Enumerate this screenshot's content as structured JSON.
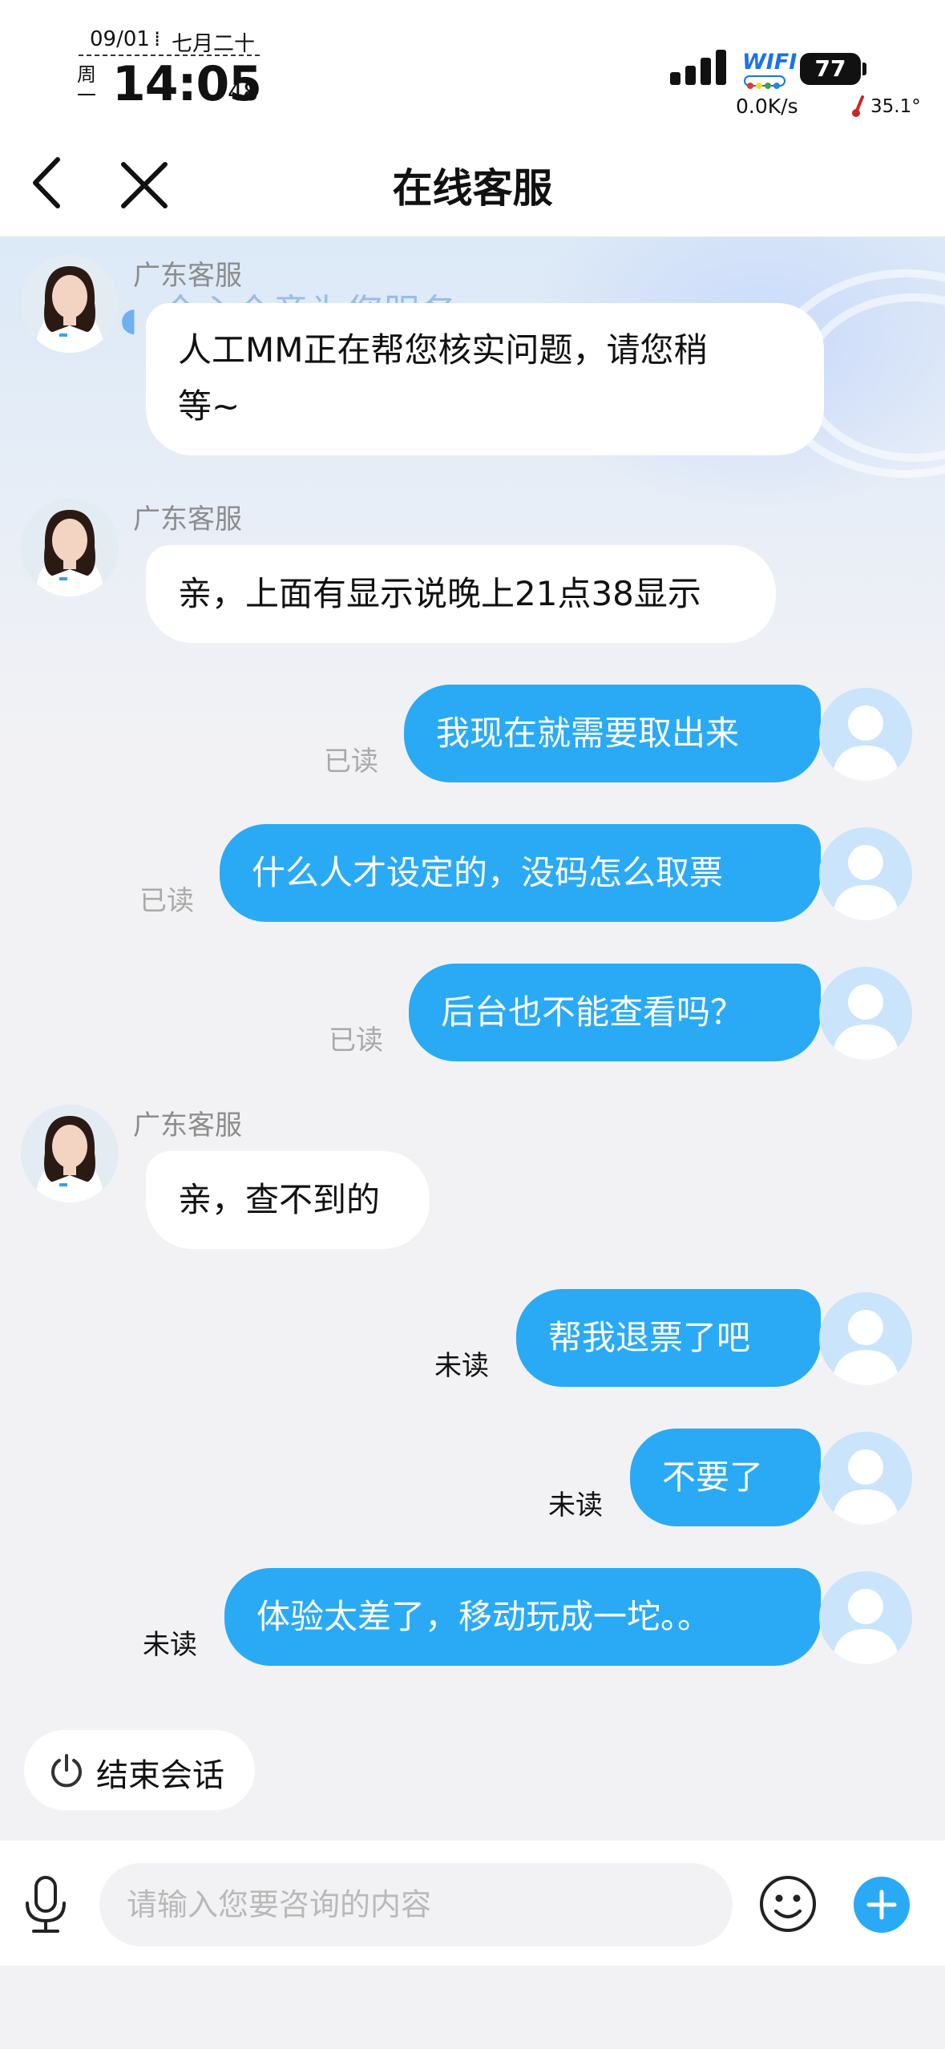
{
  "status_bar": {
    "date": "09/01",
    "lunar": "七月二十",
    "weekday": "周一",
    "time": "14:05",
    "seconds": "48",
    "wifi": "WIFI",
    "battery": "77",
    "net_speed": "0.0K/s",
    "temperature": "35.1°"
  },
  "header": {
    "title": "在线客服"
  },
  "banner": {
    "partial_text": "全心全意为您服务"
  },
  "messages": [
    {
      "sender": "广东客服",
      "text_line1": "人工MM正在帮您核实问题，请您稍",
      "text_line2": "等~"
    },
    {
      "sender": "广东客服",
      "text": "亲，上面有显示说晚上21点38显示"
    },
    {
      "text": "我现在就需要取出来",
      "status": "已读"
    },
    {
      "text": "什么人才设定的，没码怎么取票",
      "status": "已读"
    },
    {
      "text": "后台也不能查看吗？",
      "status": "已读"
    },
    {
      "sender": "广东客服",
      "text": "亲，查不到的"
    },
    {
      "text": "帮我退票了吧",
      "status": "未读"
    },
    {
      "text": "不要了",
      "status": "未读"
    },
    {
      "text": "体验太差了，移动玩成一坨。。",
      "status": "未读"
    }
  ],
  "end_session": {
    "label": "结束会话"
  },
  "input_bar": {
    "placeholder": "请输入您要咨询的内容"
  },
  "colors": {
    "accent": "#2aaaf5",
    "incoming_bubble": "#ffffff",
    "background": "#f2f2f4"
  }
}
